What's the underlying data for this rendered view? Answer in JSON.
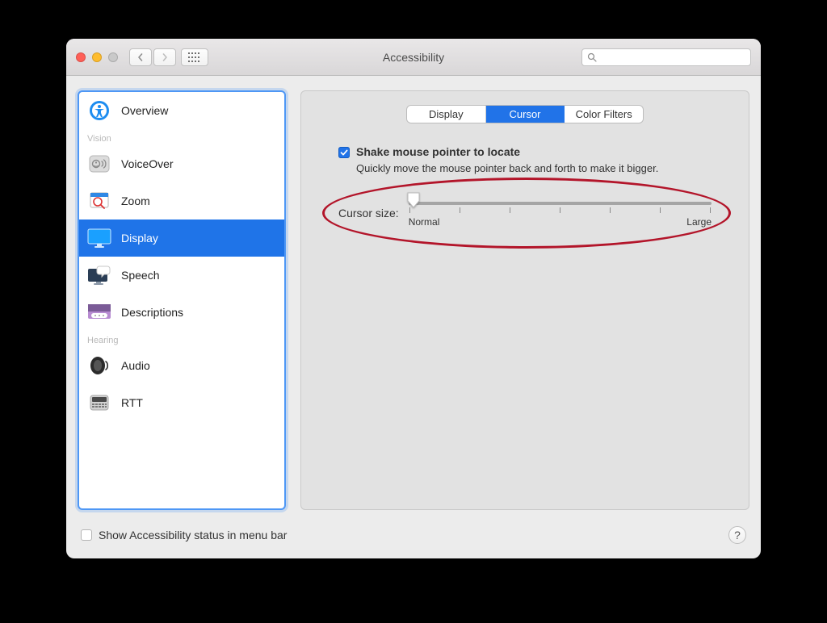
{
  "titlebar": {
    "title": "Accessibility",
    "search_placeholder": ""
  },
  "sidebar": {
    "items": [
      {
        "label": "Overview"
      },
      {
        "label": "VoiceOver"
      },
      {
        "label": "Zoom"
      },
      {
        "label": "Display"
      },
      {
        "label": "Speech"
      },
      {
        "label": "Descriptions"
      },
      {
        "label": "Audio"
      },
      {
        "label": "RTT"
      }
    ],
    "sections": {
      "vision": "Vision",
      "hearing": "Hearing"
    },
    "selected_index": 3
  },
  "tabs": {
    "items": [
      "Display",
      "Cursor",
      "Color Filters"
    ],
    "active_index": 1
  },
  "options": {
    "shake_label": "Shake mouse pointer to locate",
    "shake_hint": "Quickly move the mouse pointer back and forth to make it bigger.",
    "shake_checked": true,
    "cursor_size_label": "Cursor size:",
    "slider_min_label": "Normal",
    "slider_max_label": "Large"
  },
  "footer": {
    "menubar_label": "Show Accessibility status in menu bar",
    "menubar_checked": false,
    "help_symbol": "?"
  }
}
